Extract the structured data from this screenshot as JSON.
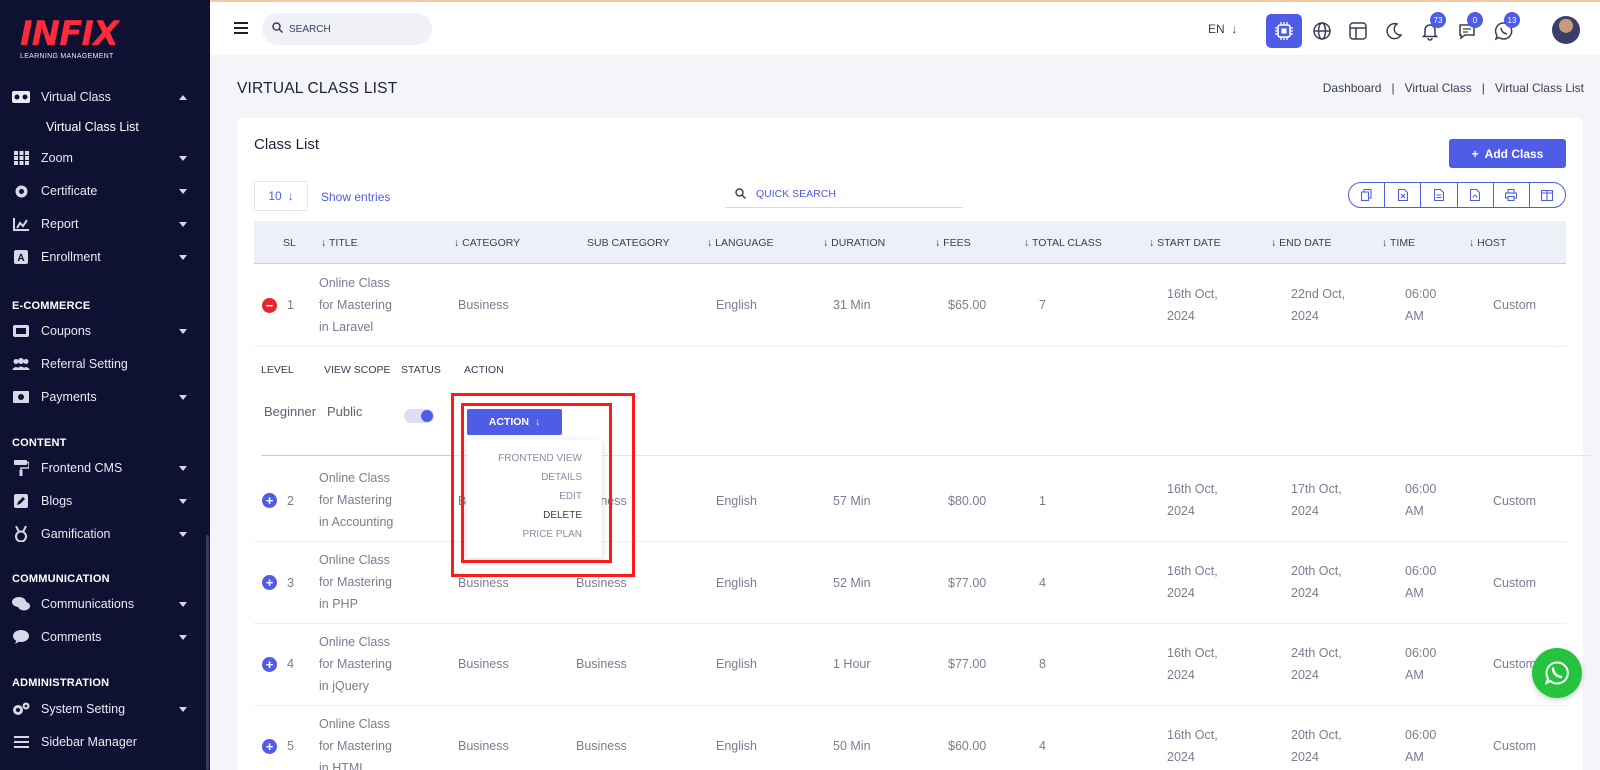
{
  "sidebar": {
    "logo_mark": "INFIX",
    "logo_sub": "LEARNING MANAGEMENT",
    "active_item": "Virtual Class",
    "active_sub": "Virtual Class List",
    "items": [
      {
        "label": "Zoom"
      },
      {
        "label": "Certificate"
      },
      {
        "label": "Report"
      },
      {
        "label": "Enrollment"
      }
    ],
    "sections": {
      "ecommerce": "E-COMMERCE",
      "content": "CONTENT",
      "communication": "COMMUNICATION",
      "administration": "ADMINISTRATION"
    },
    "ecommerce_items": [
      {
        "label": "Coupons"
      },
      {
        "label": "Referral Setting"
      },
      {
        "label": "Payments"
      }
    ],
    "content_items": [
      {
        "label": "Frontend CMS"
      },
      {
        "label": "Blogs"
      },
      {
        "label": "Gamification"
      }
    ],
    "communication_items": [
      {
        "label": "Communications"
      },
      {
        "label": "Comments"
      }
    ],
    "administration_items": [
      {
        "label": "System Setting"
      },
      {
        "label": "Sidebar Manager"
      }
    ]
  },
  "topbar": {
    "search_placeholder": "SEARCH",
    "language": "EN",
    "notifications_count": "73",
    "messages_count": "0",
    "whatsapp_count": "13"
  },
  "page": {
    "title": "VIRTUAL CLASS LIST",
    "breadcrumb": [
      "Dashboard",
      "Virtual Class",
      "Virtual Class List"
    ]
  },
  "card": {
    "title": "Class List",
    "add_button": "Add Class",
    "entries_value": "10",
    "entries_label": "Show entries",
    "quick_search": "QUICK SEARCH"
  },
  "table": {
    "headers": [
      "SL",
      "TITLE",
      "CATEGORY",
      "SUB CATEGORY",
      "LANGUAGE",
      "DURATION",
      "FEES",
      "TOTAL CLASS",
      "START DATE",
      "END DATE",
      "TIME",
      "HOST"
    ],
    "rows": [
      {
        "sl": "1",
        "title": [
          "Online Class",
          "for Mastering",
          "in Laravel"
        ],
        "category": "Business",
        "subcategory": "",
        "language": "English",
        "duration": "31 Min",
        "fees": "$65.00",
        "total": "7",
        "start": [
          "16th Oct,",
          "2024"
        ],
        "end": [
          "22nd Oct,",
          "2024"
        ],
        "time": [
          "06:00",
          "AM"
        ],
        "host": "Custom"
      },
      {
        "sl": "2",
        "title": [
          "Online Class",
          "for Mastering",
          "in Accounting"
        ],
        "category": "Business",
        "subcategory": "Business",
        "language": "English",
        "duration": "57 Min",
        "fees": "$80.00",
        "total": "1",
        "start": [
          "16th Oct,",
          "2024"
        ],
        "end": [
          "17th Oct,",
          "2024"
        ],
        "time": [
          "06:00",
          "AM"
        ],
        "host": "Custom"
      },
      {
        "sl": "3",
        "title": [
          "Online Class",
          "for Mastering",
          "in PHP"
        ],
        "category": "Business",
        "subcategory": "Business",
        "language": "English",
        "duration": "52 Min",
        "fees": "$77.00",
        "total": "4",
        "start": [
          "16th Oct,",
          "2024"
        ],
        "end": [
          "20th Oct,",
          "2024"
        ],
        "time": [
          "06:00",
          "AM"
        ],
        "host": "Custom"
      },
      {
        "sl": "4",
        "title": [
          "Online Class",
          "for Mastering",
          "in jQuery"
        ],
        "category": "Business",
        "subcategory": "Business",
        "language": "English",
        "duration": "1 Hour",
        "fees": "$77.00",
        "total": "8",
        "start": [
          "16th Oct,",
          "2024"
        ],
        "end": [
          "24th Oct,",
          "2024"
        ],
        "time": [
          "06:00",
          "AM"
        ],
        "host": "Custom"
      },
      {
        "sl": "5",
        "title": [
          "Online Class",
          "for Mastering",
          "in HTML"
        ],
        "category": "Business",
        "subcategory": "Business",
        "language": "English",
        "duration": "50 Min",
        "fees": "$60.00",
        "total": "4",
        "start": [
          "16th Oct,",
          "2024"
        ],
        "end": [
          "20th Oct,",
          "2024"
        ],
        "time": [
          "06:00",
          "AM"
        ],
        "host": "Custom"
      }
    ],
    "expanded": {
      "headers": [
        "LEVEL",
        "VIEW SCOPE",
        "STATUS",
        "ACTION"
      ],
      "level": "Beginner",
      "view_scope": "Public",
      "status_on": true,
      "action_button": "ACTION",
      "menu": [
        "FRONTEND VIEW",
        "DETAILS",
        "EDIT",
        "DELETE",
        "PRICE PLAN"
      ]
    }
  },
  "colors": {
    "accent": "#4e5ce6",
    "sidebar_bg": "#0f1133",
    "highlight": "#ff1a1a",
    "whatsapp": "#25c33e"
  }
}
